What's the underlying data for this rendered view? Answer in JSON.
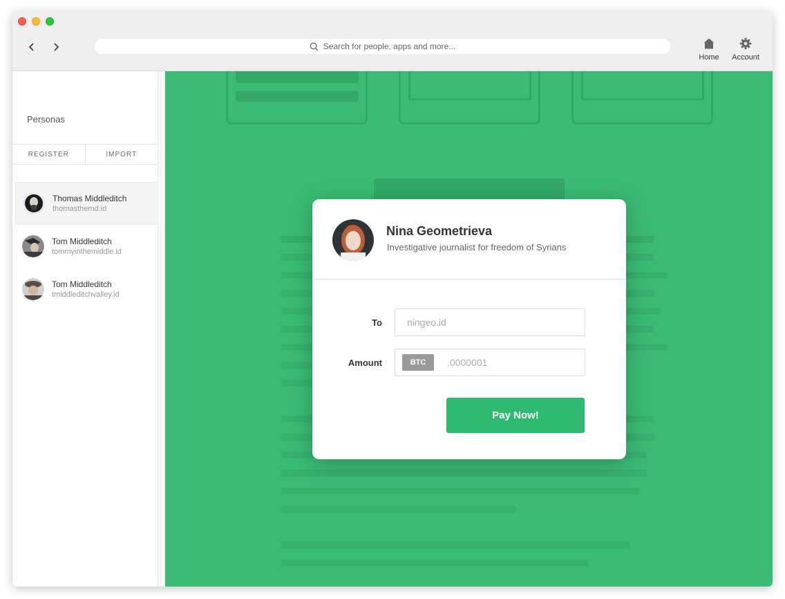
{
  "toolbar": {
    "search_placeholder": "Search for people, apps and more...",
    "home_label": "Home",
    "account_label": "Account"
  },
  "sidebar": {
    "title": "Personas",
    "tabs": [
      {
        "label": "REGISTER"
      },
      {
        "label": "IMPORT"
      }
    ],
    "personas": [
      {
        "name": "Thomas Middleditch",
        "id": "thomasthemd.id",
        "active": true
      },
      {
        "name": "Tom Middleditch",
        "id": "tommyinthemiddle.id",
        "active": false
      },
      {
        "name": "Tom Middleditch",
        "id": "tmiddleditchvalley.id",
        "active": false
      }
    ]
  },
  "modal": {
    "name": "Nina Geometrieva",
    "bio": "Investigative journalist for freedom of Syrians",
    "to_label": "To",
    "to_placeholder": "ningeo.id",
    "amount_label": "Amount",
    "currency": "BTC",
    "amount_placeholder": ".0000001",
    "pay_label": "Pay Now!"
  },
  "colors": {
    "accent_green": "#3ec07a",
    "button_green": "#2fba72"
  }
}
